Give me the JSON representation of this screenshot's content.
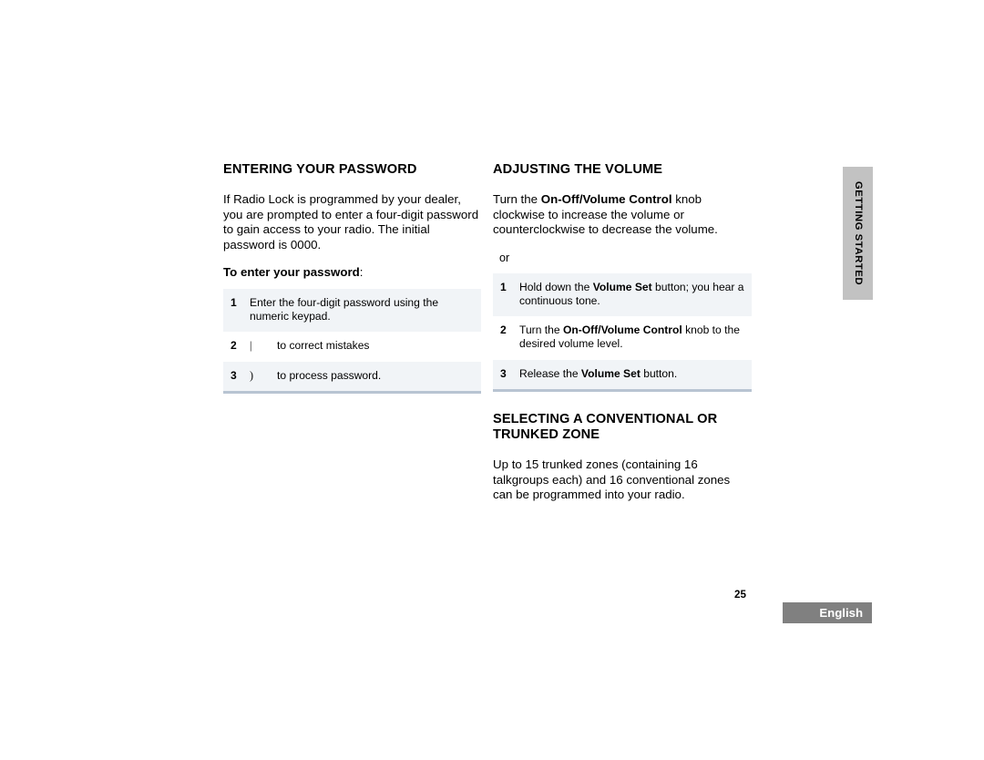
{
  "side_tab": {
    "label": "GETTING STARTED"
  },
  "left_column": {
    "heading": "ENTERING YOUR PASSWORD",
    "intro": "If Radio Lock is programmed by your dealer, you are prompted to enter a four-digit password to gain access to your radio. The initial password is 0000.",
    "lead_bold": "To enter your password",
    "lead_colon": ":",
    "steps": [
      {
        "number": "1",
        "glyph": "",
        "text": "Enter the four-digit password using the numeric keypad.",
        "shaded": true
      },
      {
        "number": "2",
        "glyph": "|",
        "text": "to correct mistakes",
        "shaded": false
      },
      {
        "number": "3",
        "glyph": ")",
        "text": "to process password.",
        "shaded": true
      }
    ]
  },
  "right_column": {
    "heading_volume": "ADJUSTING THE VOLUME",
    "volume_intro_pre": "Turn the ",
    "volume_intro_bold": "On-Off/Volume Control",
    "volume_intro_post": " knob clockwise to increase the volume or counterclockwise to decrease the volume.",
    "or_label": "or",
    "steps": [
      {
        "number": "1",
        "pre": "Hold down the ",
        "bold": "Volume Set",
        "post": " button; you hear a continuous tone.",
        "shaded": true
      },
      {
        "number": "2",
        "pre": "Turn the ",
        "bold": "On-Off/Volume Control",
        "post": " knob to the desired volume level.",
        "shaded": false
      },
      {
        "number": "3",
        "pre": "Release the ",
        "bold": "Volume Set",
        "post": " button.",
        "shaded": true
      }
    ],
    "heading_zone": "SELECTING A CONVENTIONAL OR TRUNKED ZONE",
    "zone_text": "Up to 15 trunked zones (containing 16 talkgroups each) and 16 conventional zones can be programmed into your radio."
  },
  "footer": {
    "page_number": "25",
    "language": "English"
  },
  "colors": {
    "shade_row": "#f1f4f7",
    "list_rule": "#b8c4d2",
    "side_tab_bg": "#c2c2c2",
    "badge_bg": "#808080"
  }
}
